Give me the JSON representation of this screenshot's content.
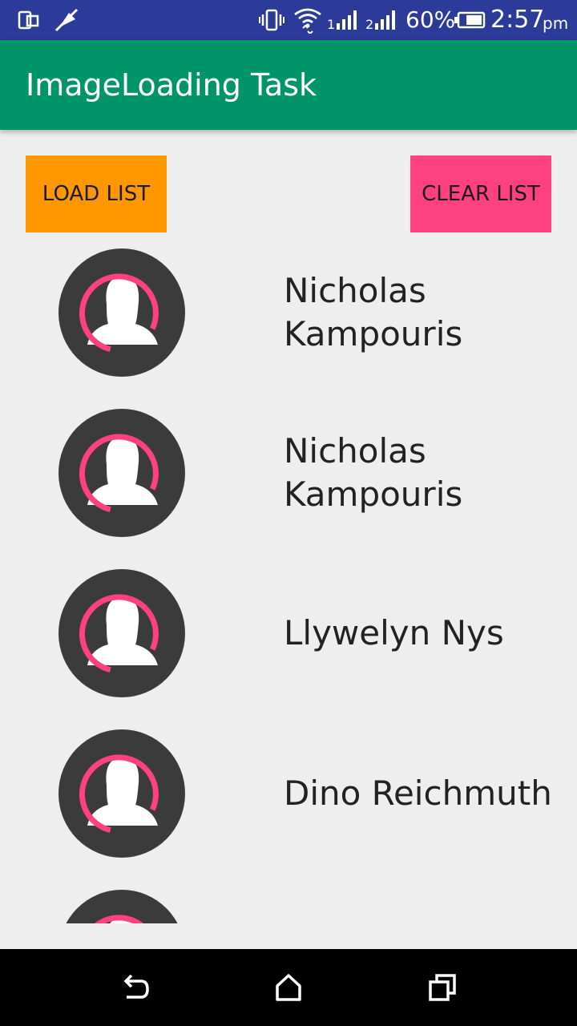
{
  "status_bar": {
    "battery": "60%",
    "time": "2:57",
    "ampm": "pm",
    "sim1": "1",
    "sim2": "2"
  },
  "app_bar": {
    "title": "ImageLoading Task"
  },
  "buttons": {
    "load": "LOAD LIST",
    "clear": "CLEAR LIST"
  },
  "list": {
    "items": [
      {
        "name": "Nicholas Kampouris"
      },
      {
        "name": "Nicholas Kampouris"
      },
      {
        "name": "Llywelyn Nys"
      },
      {
        "name": "Dino Reichmuth"
      },
      {
        "name": ""
      }
    ]
  },
  "colors": {
    "status_bar": "#2c3a99",
    "app_bar": "#009469",
    "load_button": "#ff9800",
    "clear_button": "#ff4081",
    "spinner": "#ff4081",
    "avatar_bg": "#3c3b3b"
  },
  "icons": {
    "status": [
      "screen-mirror-icon",
      "no-location-icon",
      "vibrate-icon",
      "wifi-icon",
      "signal-icon",
      "battery-icon"
    ],
    "nav": [
      "back-icon",
      "home-icon",
      "recents-icon"
    ],
    "avatar": "person-placeholder-icon"
  }
}
